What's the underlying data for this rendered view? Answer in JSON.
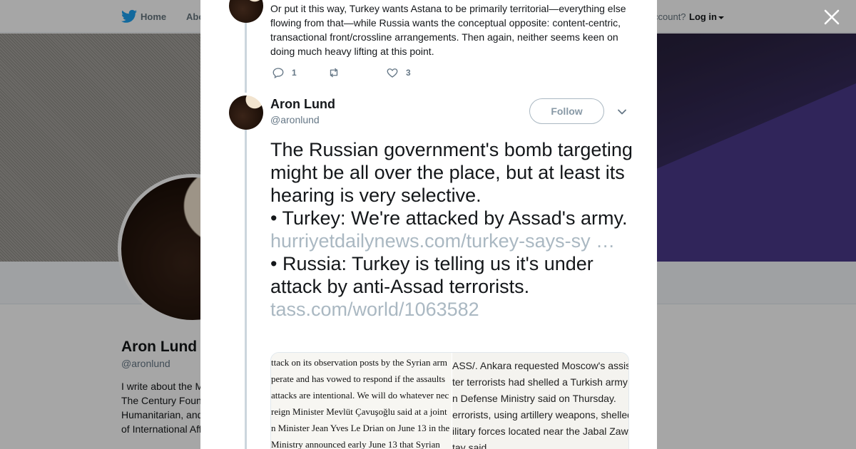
{
  "nav": {
    "home": "Home",
    "about": "Abo",
    "account_prompt": "ccount?",
    "login": "Log in"
  },
  "profile": {
    "name": "Aron Lund",
    "handle": "@aronlund",
    "bio_lines": [
      "I write about the M",
      "The Century Foun",
      "Humanitarian, and",
      "of International Aff"
    ]
  },
  "previous_tweet": {
    "text": "Or put it this way, Turkey wants Astana to be primarily territorial—everything else flowing from that—while Russia wants the conceptual opposite: content-centric, transactional front/crossline arrangements. Then again, neither seems keen on doing much heavy lifting at this point.",
    "reply_count": "1",
    "retweet_count": "",
    "like_count": "3"
  },
  "tweet": {
    "author_name": "Aron Lund",
    "author_handle": "@aronlund",
    "follow_label": "Follow",
    "line1": "The Russian government's bomb targeting might be all over the place, but at least its hearing is very selective.",
    "line2_text": "• Turkey: We're attacked by Assad's army. ",
    "line2_link": "hurriyetdailynews.com/turkey-says-sy  …",
    "line3_text": "• Russia: Turkey is telling us it's under attack by anti-Assad terrorists.",
    "line3_link": " tass.com/world/1063582"
  },
  "media": {
    "left_lines": [
      "ttack on its observation posts by the Syrian arm",
      "perate and has vowed to respond if the assaults",
      "attacks are intentional. We will do whatever nec",
      "reign Minister Mevlüt Çavuşoğlu said at a joint",
      "n Minister Jean Yves Le Drian on June 13 in the",
      "Ministry announced early June 13 that Syrian"
    ],
    "right_lines": [
      "ASS/. Ankara requested Moscow's assis",
      "ter terrorists had shelled a Turkish army",
      "n Defense Ministry said on Thursday.",
      "errorists, using artillery weapons, shelled",
      "ilitary forces located near the Jabal Zaw",
      "tay said."
    ]
  },
  "colors": {
    "twitter_blue": "#1da1f2",
    "text_primary": "#14171a",
    "text_secondary": "#657786",
    "link_faded": "#aab8c2"
  },
  "icons": [
    "twitter-bird-icon",
    "close-icon",
    "reply-icon",
    "retweet-icon",
    "like-icon",
    "chevron-down-icon"
  ]
}
